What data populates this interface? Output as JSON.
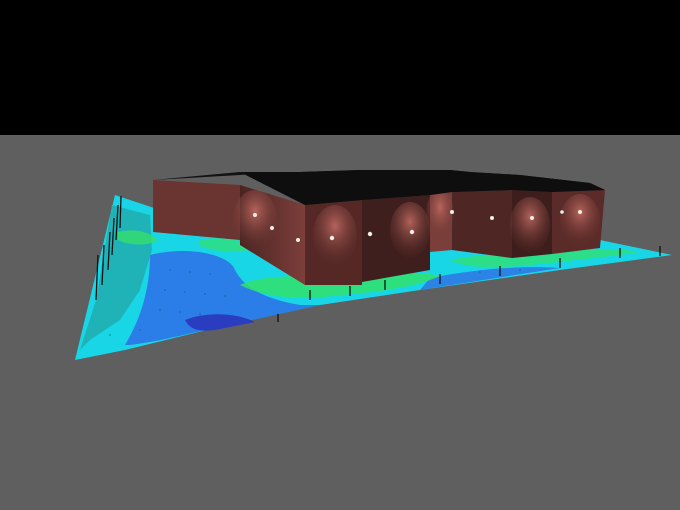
{
  "scene": {
    "colors": {
      "sky": "#000000",
      "ground": "#5f5f5f",
      "roof": "#121212",
      "wall_light": "#7a3f3a",
      "wall_dark": "#4a2422",
      "iso_cyan": "#19d6e6",
      "iso_teal": "#1fb3b8",
      "iso_green": "#33e06a",
      "iso_blue": "#2f6ee6",
      "iso_deep_blue": "#2a3dc0",
      "wall_lamp": "#f2eee6"
    },
    "building": {
      "description_icon": "building-icon"
    },
    "light_poles": {
      "icon": "light-pole-icon"
    }
  }
}
